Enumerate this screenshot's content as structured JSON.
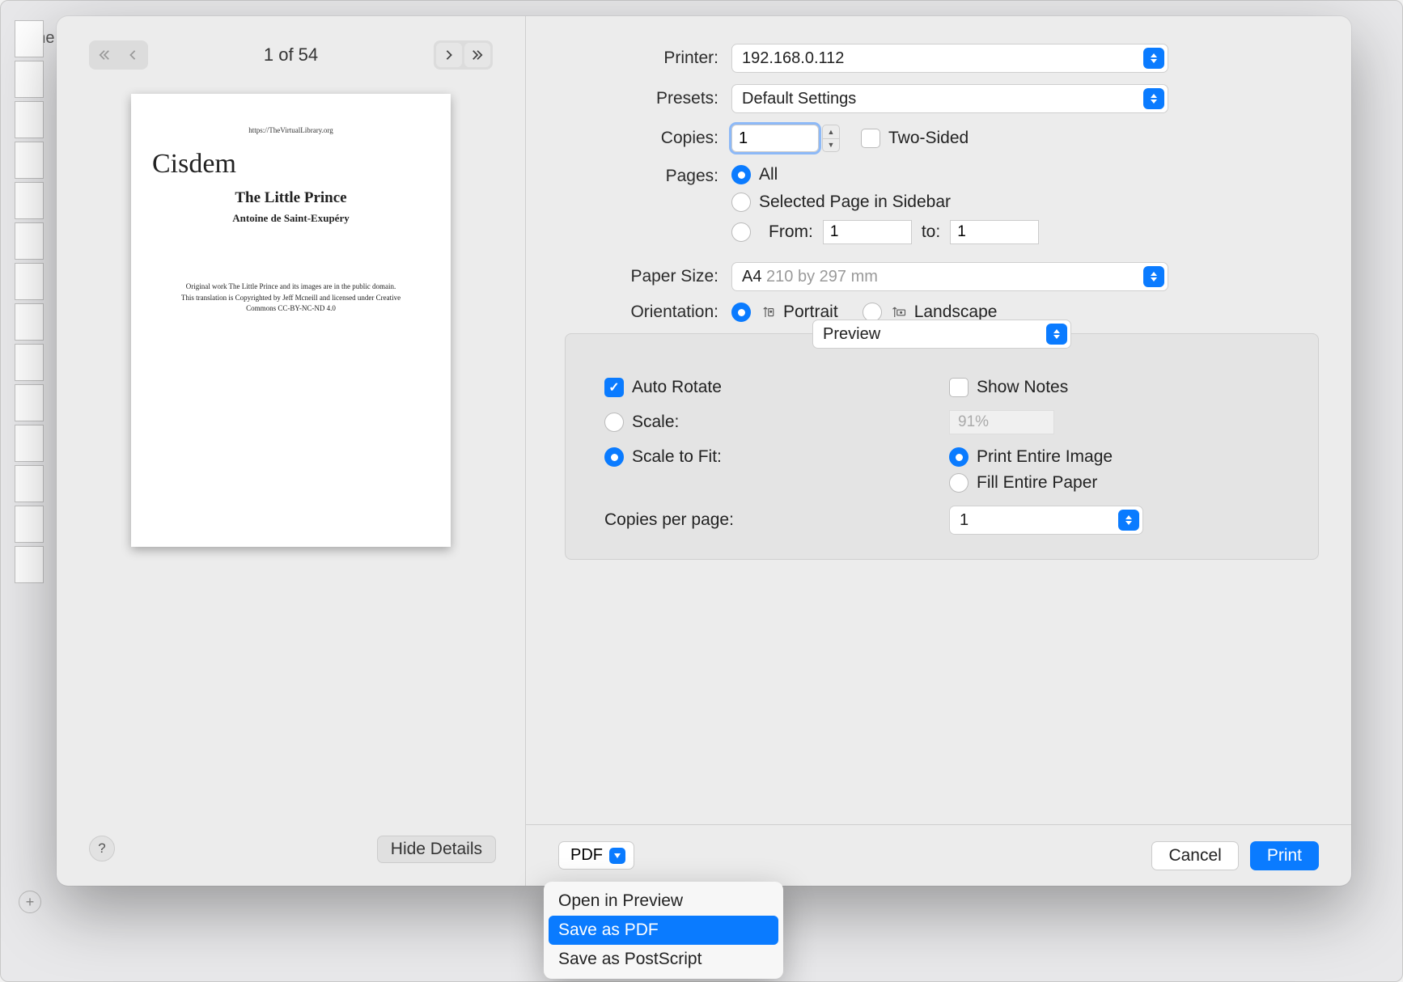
{
  "background": {
    "truncated_title": "The",
    "plus_tooltip": "+"
  },
  "pager": {
    "label": "1 of 54"
  },
  "preview_doc": {
    "url": "https://TheVirtualLibrary.org",
    "brand": "Cisdem",
    "title": "The Little Prince",
    "author": "Antoine de Saint-Exupéry",
    "copyright_line1": "Original work The Little Prince and its images are in the public domain.",
    "copyright_line2": "This translation is Copyrighted by Jeff Mcneill and licensed under Creative",
    "copyright_line3": "Commons CC-BY-NC-ND 4.0"
  },
  "help": "?",
  "hide_details": "Hide Details",
  "labels": {
    "printer": "Printer:",
    "presets": "Presets:",
    "copies": "Copies:",
    "two_sided": "Two-Sided",
    "pages": "Pages:",
    "all": "All",
    "selected_sidebar": "Selected Page in Sidebar",
    "from": "From:",
    "to": "to:",
    "paper_size": "Paper Size:",
    "orientation": "Orientation:",
    "portrait": "Portrait",
    "landscape": "Landscape"
  },
  "values": {
    "printer": "192.168.0.112",
    "presets": "Default Settings",
    "copies": "1",
    "from": "1",
    "to": "1",
    "paper_size": "A4",
    "paper_dims": "210 by 297 mm"
  },
  "panel": {
    "app_menu": "Preview",
    "auto_rotate": "Auto Rotate",
    "show_notes": "Show Notes",
    "scale": "Scale:",
    "scale_value": "91%",
    "scale_to_fit": "Scale to Fit:",
    "print_entire": "Print Entire Image",
    "fill_entire": "Fill Entire Paper",
    "copies_per_page_label": "Copies per page:",
    "copies_per_page_value": "1"
  },
  "buttons": {
    "pdf": "PDF",
    "cancel": "Cancel",
    "print": "Print"
  },
  "pdf_menu": {
    "open_preview": "Open in Preview",
    "save_pdf": "Save as PDF",
    "save_ps": "Save as PostScript"
  }
}
